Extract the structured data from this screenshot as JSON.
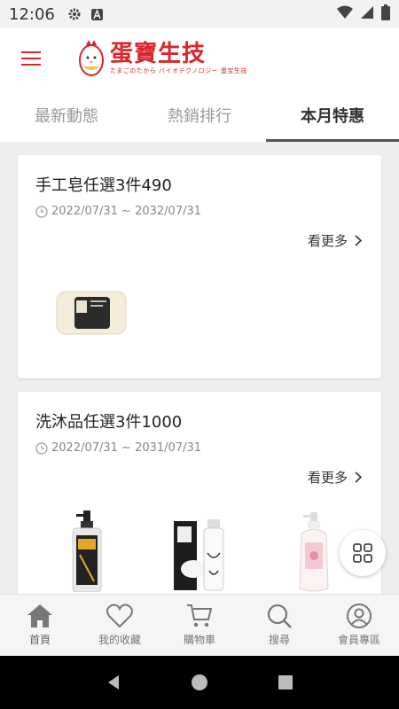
{
  "status_bar": {
    "time": "12:06"
  },
  "header": {
    "logo_title": "蛋寶生技",
    "logo_subtitle": "たまごのたから バイオテクノロジー 蛋宝生技",
    "brand_color": "#d9262b"
  },
  "tabs": [
    {
      "label": "最新動態"
    },
    {
      "label": "熱銷排行"
    },
    {
      "label": "本月特惠"
    }
  ],
  "promotions": [
    {
      "title": "手工皂任選3件490",
      "date_range": "2022/07/31 ~ 2032/07/31",
      "more_label": "看更多"
    },
    {
      "title": "洗沐品任選3件1000",
      "date_range": "2022/07/31 ~ 2031/07/31",
      "more_label": "看更多"
    }
  ],
  "bottom_nav": [
    {
      "label": "首頁",
      "icon": "home-icon"
    },
    {
      "label": "我的收藏",
      "icon": "heart-icon"
    },
    {
      "label": "購物車",
      "icon": "cart-icon"
    },
    {
      "label": "搜尋",
      "icon": "search-icon"
    },
    {
      "label": "會員專區",
      "icon": "user-icon"
    }
  ]
}
